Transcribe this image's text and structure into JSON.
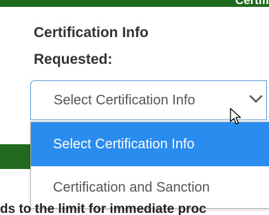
{
  "header": {
    "partial_text": "Certifi",
    "bar_color": "#1f6a1f"
  },
  "form": {
    "label_line1": "Certification Info",
    "label_line2": "Requested:",
    "select": {
      "value": "Select Certification Info",
      "options": [
        {
          "label": "Select Certification Info",
          "selected": true
        },
        {
          "label": "Certification and Sanction",
          "selected": false
        }
      ],
      "highlight_color": "#2b8cef",
      "border_color": "#5b9bd5",
      "icon": "chevron-down-icon"
    }
  },
  "cursor": {
    "icon": "mouse-pointer-icon"
  },
  "background_text": {
    "partial": "ds to the limit for immediate proc"
  }
}
